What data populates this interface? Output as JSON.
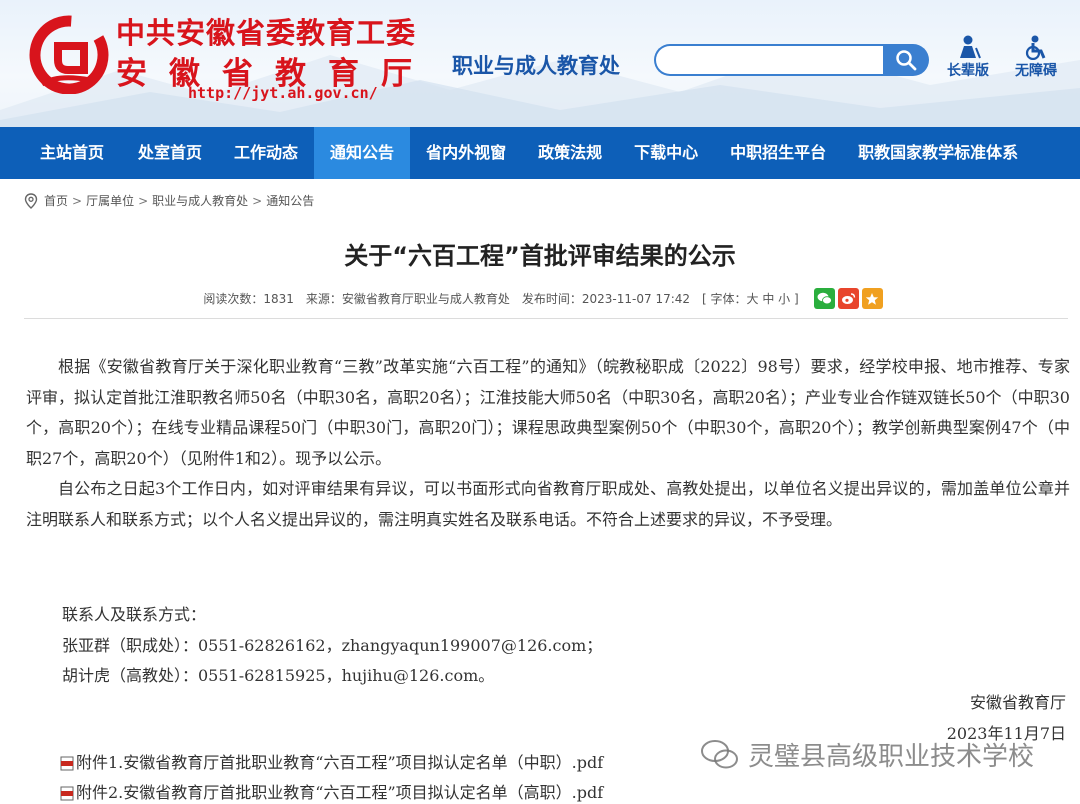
{
  "header": {
    "org_line_1": "中共安徽省委教育工委",
    "org_line_2": "安徽省教育厅",
    "department": "职业与成人教育处",
    "url": "http://jyt.ah.gov.cn/",
    "search_placeholder": "",
    "tools": [
      {
        "label": "长辈版",
        "icon": "elder-mode-icon"
      },
      {
        "label": "无障碍",
        "icon": "accessibility-icon"
      }
    ],
    "colors": {
      "brand_red": "#d8141c",
      "brand_blue": "#1a56a8",
      "nav_bg": "#0d5fb8",
      "nav_active": "#2b8ae0"
    }
  },
  "nav": {
    "items": [
      {
        "label": "主站首页"
      },
      {
        "label": "处室首页"
      },
      {
        "label": "工作动态"
      },
      {
        "label": "通知公告",
        "active": true
      },
      {
        "label": "省内外视窗"
      },
      {
        "label": "政策法规"
      },
      {
        "label": "下载中心"
      },
      {
        "label": "中职招生平台"
      },
      {
        "label": "职教国家教学标准体系"
      }
    ]
  },
  "breadcrumb": [
    "首页",
    "厅属单位",
    "职业与成人教育处",
    "通知公告"
  ],
  "breadcrumb_sep": ">",
  "article": {
    "title": "关于“六百工程”首批评审结果的公示",
    "meta": {
      "views": "阅读次数：1831",
      "source": "来源：安徽省教育厅职业与成人教育处",
      "published": "发布时间：2023-11-07 17:42",
      "font_size": "[ 字体：大 中 小 ]"
    },
    "share_icons": [
      "wechat-icon",
      "weibo-icon",
      "favorite-icon"
    ],
    "paragraphs": [
      "根据《安徽省教育厅关于深化职业教育“三教”改革实施“六百工程”的通知》（皖教秘职成〔2022〕98号）要求，经学校申报、地市推荐、专家评审，拟认定首批江淮职教名师50名（中职30名，高职20名）；江淮技能大师50名（中职30名，高职20名）；产业专业合作链双链长50个（中职30个，高职20个）；在线专业精品课程50门（中职30门，高职20门）；课程思政典型案例50个（中职30个，高职20个）；教学创新典型案例47个（中职27个，高职20个）（见附件1和2）。现予以公示。",
      "自公布之日起3个工作日内，如对评审结果有异议，可以书面形式向省教育厅职成处、高教处提出，以单位名义提出异议的，需加盖单位公章并注明联系人和联系方式；以个人名义提出异议的，需注明真实姓名及联系电话。不符合上述要求的异议，不予受理。"
    ],
    "contacts_heading": "联系人及联系方式：",
    "contacts": [
      "张亚群（职成处）：0551-62826162，zhangyaqun199007@126.com；",
      "胡计虎（高教处）：0551-62815925，hujihu@126.com。"
    ],
    "signer": "安徽省教育厅",
    "date": "2023年11月7日",
    "attachments": [
      "附件1.安徽省教育厅首批职业教育“六百工程”项目拟认定名单（中职）.pdf",
      "附件2.安徽省教育厅首批职业教育“六百工程”项目拟认定名单（高职）.pdf"
    ]
  },
  "watermark": "灵璧县高级职业技术学校"
}
